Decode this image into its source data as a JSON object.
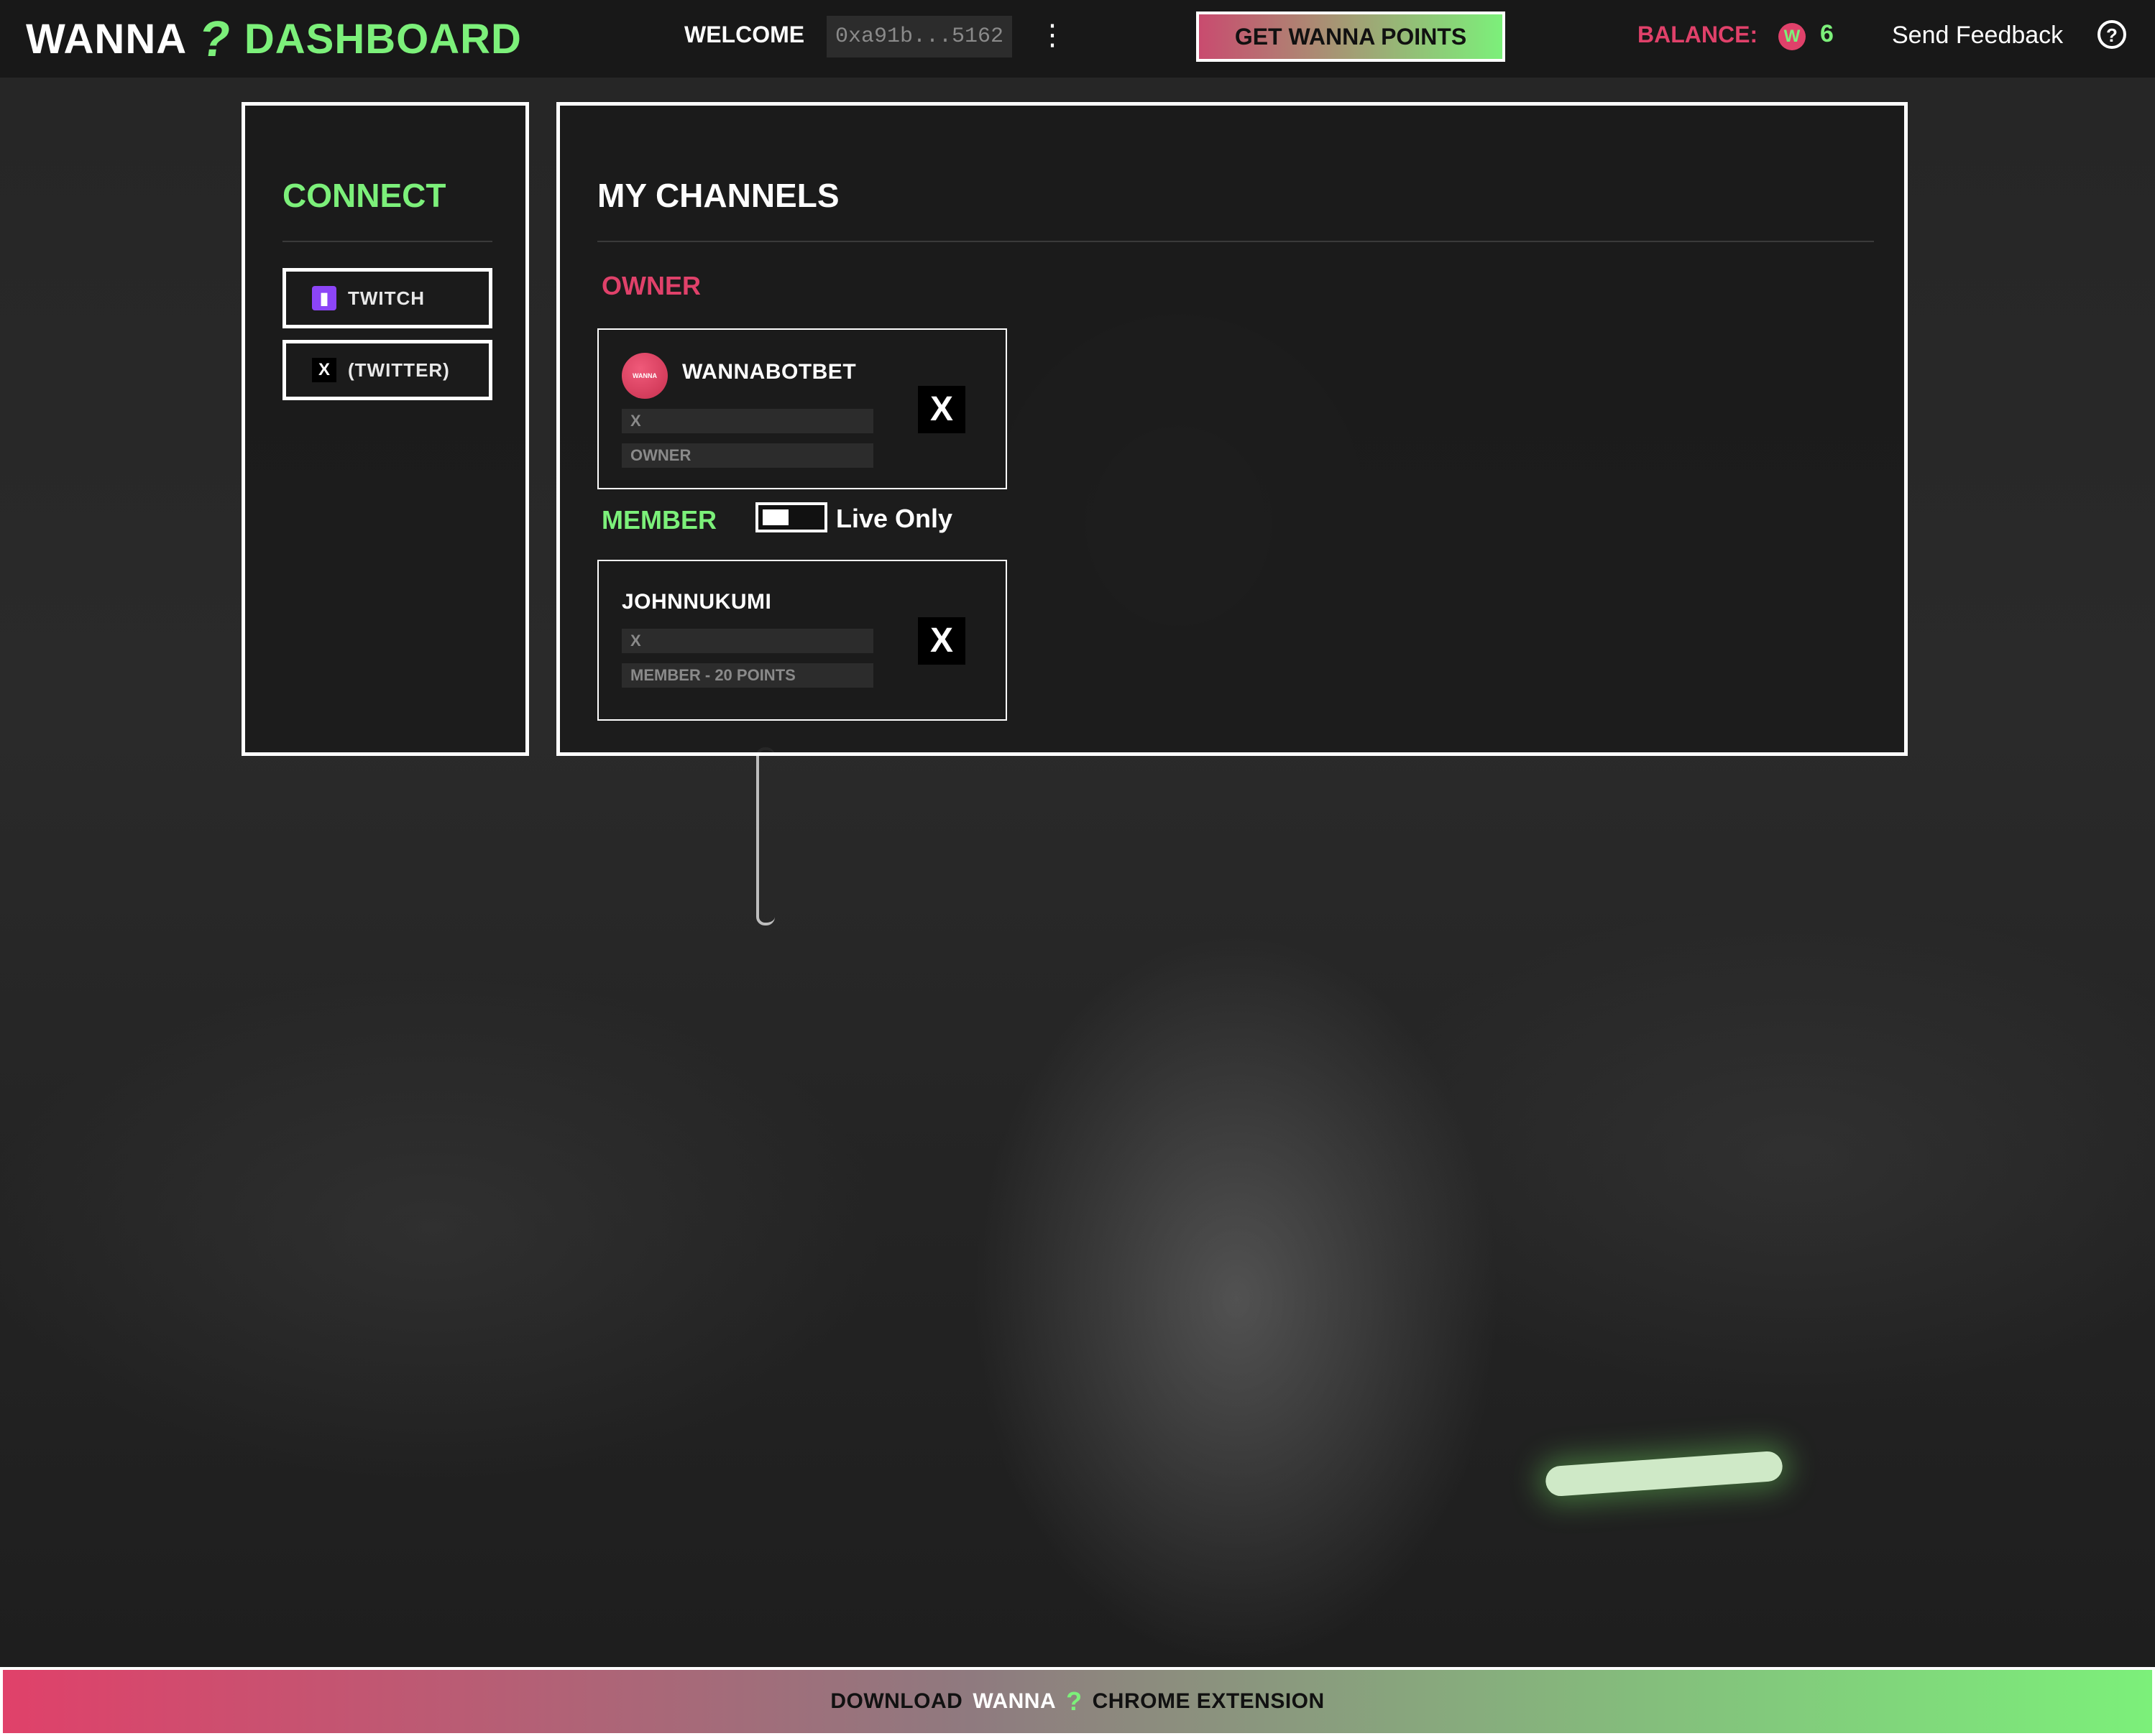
{
  "header": {
    "logo_word": "WANNA",
    "logo_mark": "?",
    "logo_dashboard": "DASHBOARD",
    "welcome_label": "WELCOME",
    "wallet_address": "0xa91b...5162",
    "menu_glyph": "⋮",
    "get_points_label": "GET WANNA POINTS",
    "balance_label": "BALANCE:",
    "balance_coin": "W",
    "balance_value": "6",
    "feedback_label": "Send Feedback",
    "help_glyph": "?"
  },
  "connect": {
    "title": "CONNECT",
    "buttons": [
      {
        "icon": "twitch-icon",
        "glyph": "▮",
        "label": "TWITCH"
      },
      {
        "icon": "x-icon",
        "glyph": "X",
        "label": "(TWITTER)"
      }
    ]
  },
  "channels": {
    "title": "MY CHANNELS",
    "owner_heading": "OWNER",
    "member_heading": "MEMBER",
    "live_only_label": "Live Only",
    "live_only_enabled": false,
    "owner_cards": [
      {
        "avatar_text": "WANNA",
        "name": "WANNABOTBET",
        "platform": "X",
        "role": "OWNER",
        "action_glyph": "X"
      }
    ],
    "member_cards": [
      {
        "name": "JOHNNUKUMI",
        "platform": "X",
        "role": "MEMBER - 20 POINTS",
        "action_glyph": "X"
      }
    ]
  },
  "banner": {
    "prefix": "DOWNLOAD",
    "brand": "WANNA",
    "mark": "?",
    "suffix": "CHROME EXTENSION"
  },
  "colors": {
    "accent_green": "#7cf07a",
    "accent_pink": "#e0416a",
    "background": "#1b1b1b"
  }
}
